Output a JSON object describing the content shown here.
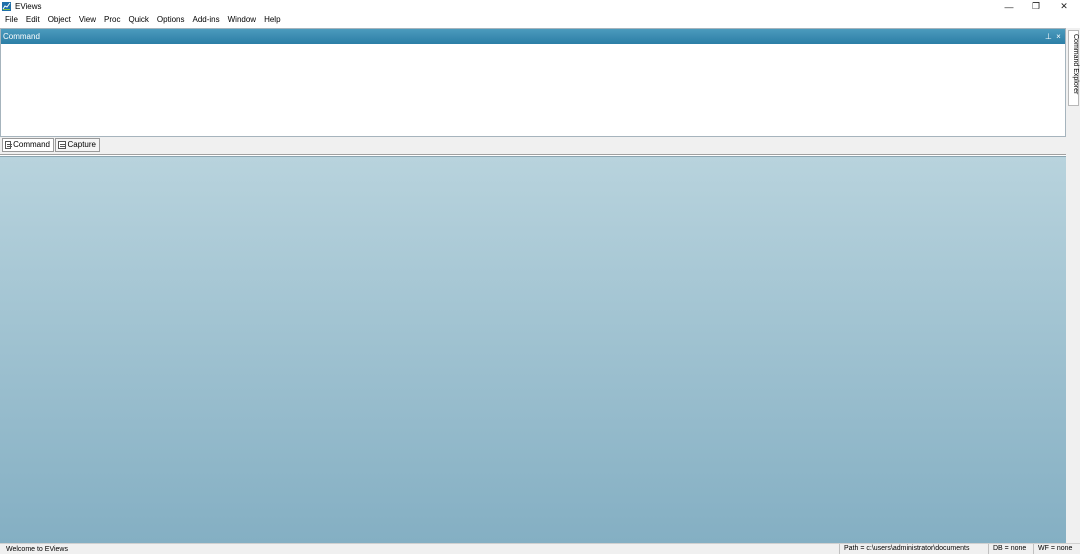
{
  "window": {
    "title": "EViews",
    "minimize_glyph": "—",
    "restore_glyph": "❐",
    "close_glyph": "✕",
    "icon": "eviews-logo-icon"
  },
  "menu": {
    "items": [
      {
        "label": "File"
      },
      {
        "label": "Edit"
      },
      {
        "label": "Object"
      },
      {
        "label": "View"
      },
      {
        "label": "Proc"
      },
      {
        "label": "Quick"
      },
      {
        "label": "Options"
      },
      {
        "label": "Add-ins"
      },
      {
        "label": "Window"
      },
      {
        "label": "Help"
      }
    ]
  },
  "command_pane": {
    "title": "Command",
    "pin_glyph": "⊥",
    "close_glyph": "×",
    "value": ""
  },
  "side_panel": {
    "tab_label": "Command Explorer"
  },
  "tabs": [
    {
      "label": "Command",
      "icon": "command-window-icon",
      "active": true
    },
    {
      "label": "Capture",
      "icon": "capture-window-icon",
      "active": false
    }
  ],
  "status": {
    "message": "Welcome to EViews",
    "path": "Path = c:\\users\\administrator\\documents",
    "db": "DB = none",
    "wf": "WF = none"
  },
  "colors": {
    "pane_header": "#2c7ea6",
    "workspace_top": "#b8d3dd",
    "workspace_bottom": "#84afc3"
  }
}
